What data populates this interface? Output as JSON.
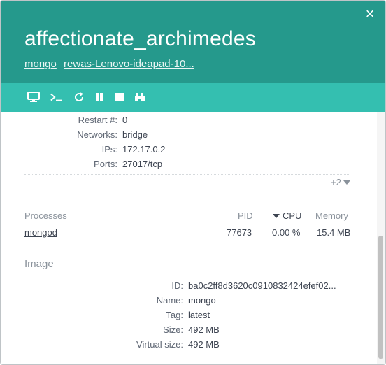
{
  "header": {
    "title": "affectionate_archimedes",
    "crumbs": [
      "mongo",
      "rewas-Lenovo-ideapad-10..."
    ],
    "close_glyph": "×",
    "bg_color": "#25998c"
  },
  "toolbar": {
    "bg_color": "#34bfb0",
    "icons": [
      "monitor-icon",
      "terminal-icon",
      "restart-icon",
      "pause-icon",
      "stop-icon",
      "binoculars-icon"
    ]
  },
  "details": {
    "restart_label": "Restart #:",
    "restart_value": "0",
    "networks_label": "Networks:",
    "networks_value": "bridge",
    "ips_label": "IPs:",
    "ips_value": "172.17.0.2",
    "ports_label": "Ports:",
    "ports_value": "27017/tcp",
    "more_label": "+2"
  },
  "processes": {
    "headers": {
      "name": "Processes",
      "pid": "PID",
      "cpu": "CPU",
      "memory": "Memory"
    },
    "rows": [
      {
        "name": "mongod",
        "pid": "77673",
        "cpu": "0.00 %",
        "memory": "15.4 MB"
      }
    ]
  },
  "image": {
    "section_title": "Image",
    "id_label": "ID:",
    "id_value": "ba0c2ff8d3620c0910832424efef02...",
    "name_label": "Name:",
    "name_value": "mongo",
    "tag_label": "Tag:",
    "tag_value": "latest",
    "size_label": "Size:",
    "size_value": "492 MB",
    "vsize_label": "Virtual size:",
    "vsize_value": "492 MB"
  }
}
